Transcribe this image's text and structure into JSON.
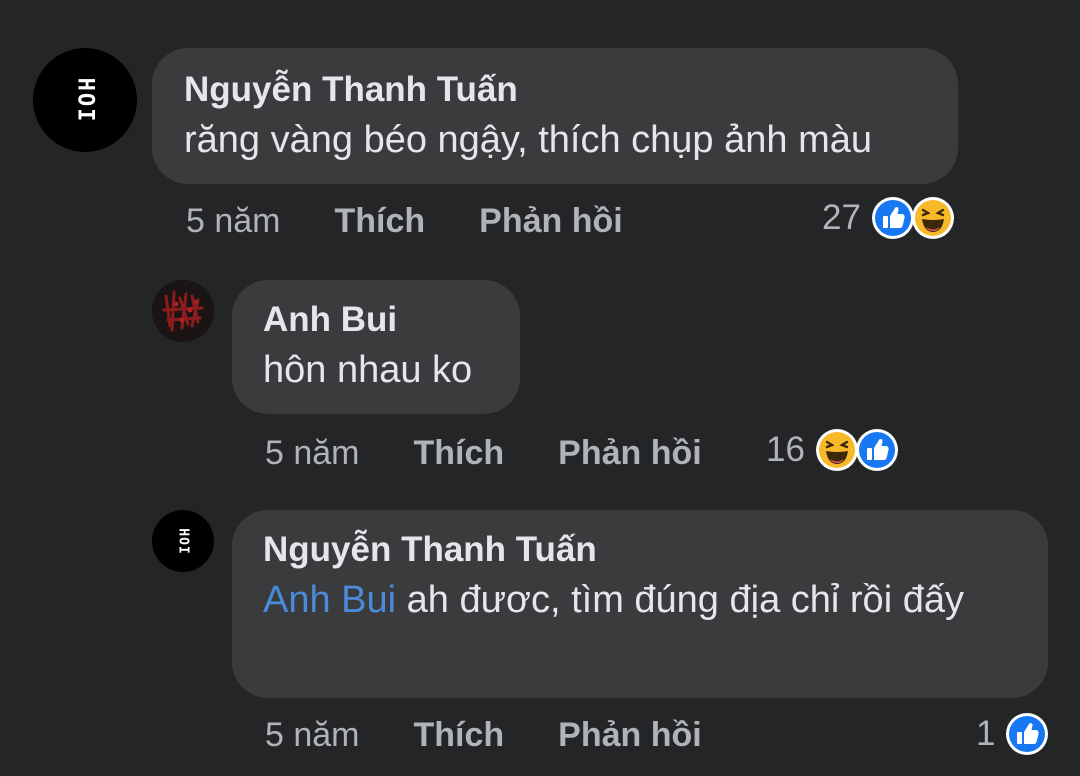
{
  "comments": [
    {
      "avatar_text": "HOI",
      "author": "Nguyễn Thanh Tuấn",
      "text": "răng vàng béo ngậy, thích chụp ảnh màu",
      "time": "5 năm",
      "like": "Thích",
      "reply": "Phản hồi",
      "reaction_count": "27",
      "reactions": [
        "like-icon",
        "haha-icon"
      ]
    },
    {
      "author": "Anh Bui",
      "text": "hôn nhau ko",
      "time": "5 năm",
      "like": "Thích",
      "reply": "Phản hồi",
      "reaction_count": "16",
      "reactions": [
        "haha-icon",
        "like-icon"
      ]
    },
    {
      "avatar_text": "HOI",
      "author": "Nguyễn Thanh Tuấn",
      "mention": "Anh Bui",
      "text": " ah đươc, tìm đúng địa chỉ rồi đấy",
      "time": "5 năm",
      "like": "Thích",
      "reply": "Phản hồi",
      "reaction_count": "1",
      "reactions": [
        "like-icon"
      ]
    }
  ],
  "colors": {
    "background": "#242526",
    "bubble": "#3a3b3c",
    "mention": "#4b8ad8",
    "like_blue": "#1877f2",
    "haha_yellow": "#f7b928"
  }
}
